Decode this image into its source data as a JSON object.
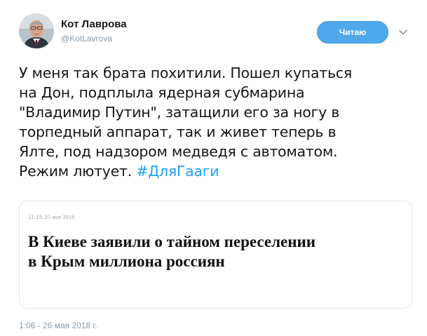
{
  "author": {
    "display_name": "Кот Лаврова",
    "handle": "@KotLavrova",
    "avatar_icon": "profile-photo"
  },
  "follow_button": {
    "label": "Читаю",
    "color": "#4fa8ea"
  },
  "menu": {
    "icon": "chevron-down-icon"
  },
  "tweet": {
    "lines": [
      "У меня так брата похитили. Пошел купаться",
      "на Дон, подплыла ядерная субмарина",
      "\"Владимир Путин\", затащили его за ногу в",
      "торпедный аппарат, так и живет теперь в",
      "Ялте, под надзором медведя с автоматом."
    ],
    "last_line_text": "Режим лютует. ",
    "hashtag": "#ДляГааги",
    "hashtag_color": "#1da1f2"
  },
  "card": {
    "time": "21:19, 25 мая 2018",
    "headline_lines": [
      "В Киеве заявили о тайном переселении",
      "в Крым миллиона россиян"
    ]
  },
  "timestamp": "1:06 - 26 мая 2018 г."
}
